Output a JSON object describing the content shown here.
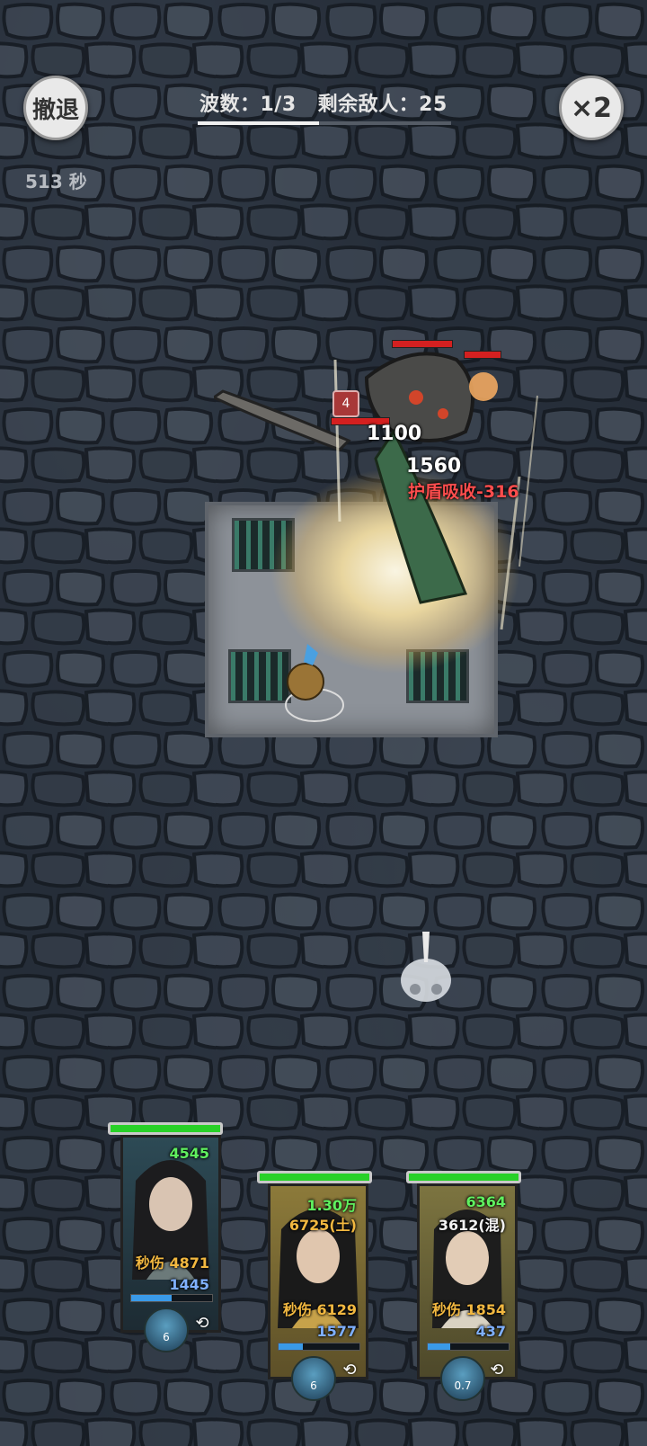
{
  "hud": {
    "retreat_label": "撤退",
    "speed_label": "×2",
    "timer": "513 秒",
    "wave_label": "波数：1/3",
    "enemies_label": "剩余敌人：25",
    "wave_progress": 0.48
  },
  "combat": {
    "damage_numbers": [
      "1100",
      "1560"
    ],
    "shield_text": "护盾吸收-316",
    "buff_stack": "4"
  },
  "heroes": [
    {
      "hp": "4545",
      "dps": "秒伤 4871",
      "mp": "1445",
      "skill_value": "6",
      "hp_fraction": 1.0,
      "mp_fraction": 0.5
    },
    {
      "hp": "1.30万",
      "element": "6725(土)",
      "dps": "秒伤 6129",
      "mp": "1577",
      "skill_value": "6",
      "hp_fraction": 1.0,
      "mp_fraction": 0.3
    },
    {
      "hp": "6364",
      "element": "3612(混)",
      "dps": "秒伤 1854",
      "mp": "437",
      "skill_value": "0.7",
      "hp_fraction": 1.0,
      "mp_fraction": 0.28
    }
  ]
}
